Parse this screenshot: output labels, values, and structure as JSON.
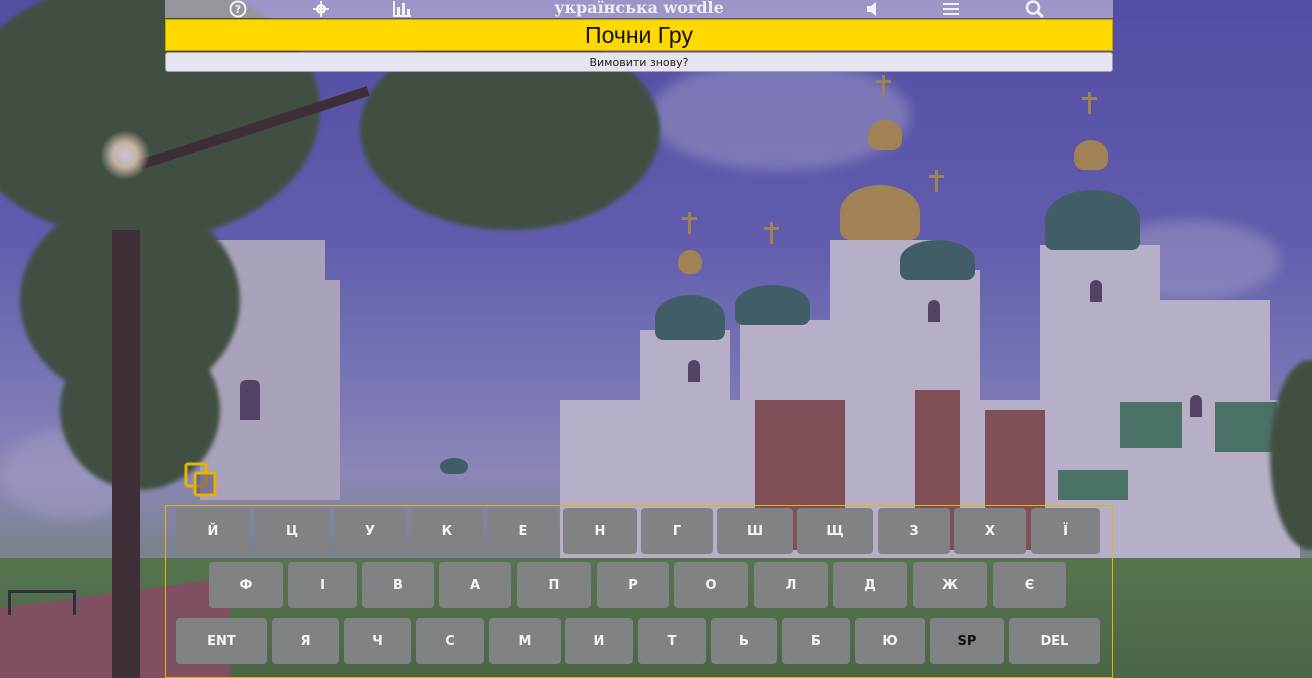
{
  "header": {
    "title": "українська wordle",
    "icons": [
      "help-icon",
      "settings-icon",
      "stats-icon",
      "speaker-icon",
      "menu-icon",
      "search-icon"
    ]
  },
  "banner": {
    "text": "Почни Гру"
  },
  "speak_again": {
    "label": "Вимовити знову?"
  },
  "copy_icon": "copy-icon",
  "keyboard": {
    "row1": [
      "Й",
      "Ц",
      "У",
      "К",
      "Е",
      "Н",
      "Г",
      "Ш",
      "Щ",
      "З",
      "Х",
      "Ї"
    ],
    "row2": [
      "Ф",
      "І",
      "В",
      "А",
      "П",
      "Р",
      "О",
      "Л",
      "Д",
      "Ж",
      "Є"
    ],
    "row3": [
      "ENT",
      "Я",
      "Ч",
      "С",
      "М",
      "И",
      "Т",
      "Ь",
      "Б",
      "Ю",
      "SP",
      "DEL"
    ]
  },
  "colors": {
    "banner": "#ffd800",
    "key": "#808283",
    "keyboard_border": "#e3b400"
  }
}
